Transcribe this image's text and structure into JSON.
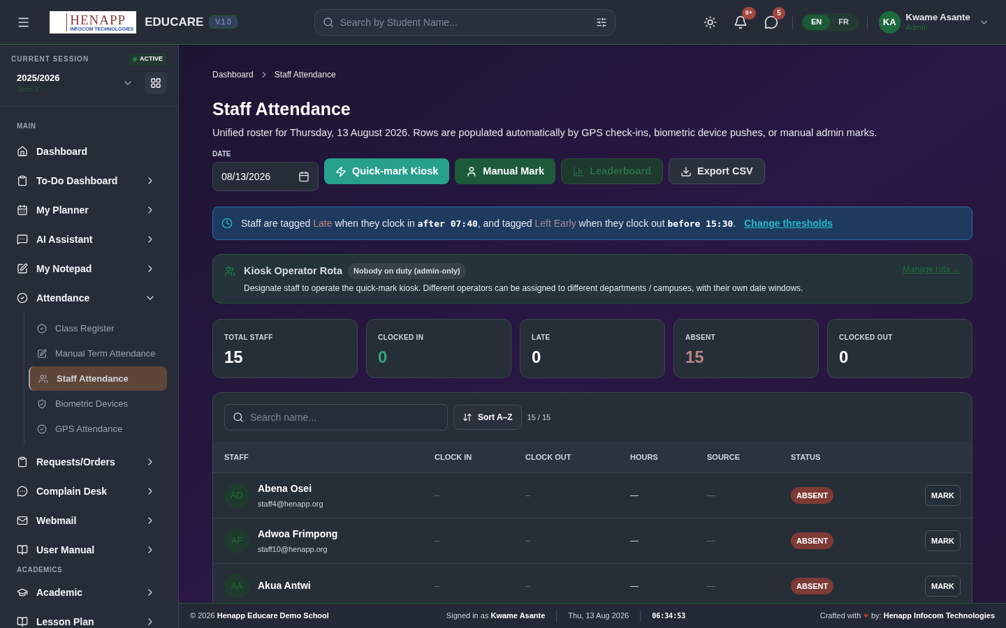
{
  "header": {
    "logo": {
      "name": "HENAPP",
      "tagline": "INFOCOM TECHNOLOGIES"
    },
    "app_name": "EDUCARE",
    "version": "V.1.0",
    "search": {
      "placeholder": "Search by Student Name..."
    },
    "notifications_badge": "9+",
    "messages_badge": "5",
    "languages": [
      {
        "label": "EN",
        "selected": true
      },
      {
        "label": "FR",
        "selected": false
      }
    ],
    "user": {
      "initials": "KA",
      "name": "Kwame Asante",
      "role": "Admin"
    }
  },
  "sidebar": {
    "session_label": "CURRENT SESSION",
    "session_badge": "ACTIVE",
    "session_year": "2025/2026",
    "session_term": "Term 3",
    "sections": [
      {
        "title": "MAIN",
        "items": [
          {
            "label": "Dashboard",
            "expandable": false
          },
          {
            "label": "To-Do Dashboard",
            "expandable": true,
            "expanded": false
          },
          {
            "label": "My Planner",
            "expandable": true,
            "expanded": false
          },
          {
            "label": "AI Assistant",
            "expandable": true,
            "expanded": false
          },
          {
            "label": "My Notepad",
            "expandable": true,
            "expanded": false
          },
          {
            "label": "Attendance",
            "expandable": true,
            "expanded": true,
            "children": [
              {
                "label": "Class Register",
                "selected": false
              },
              {
                "label": "Manual Term Attendance",
                "selected": false
              },
              {
                "label": "Staff Attendance",
                "selected": true
              },
              {
                "label": "Biometric Devices",
                "selected": false
              },
              {
                "label": "GPS Attendance",
                "selected": false
              }
            ]
          },
          {
            "label": "Requests/Orders",
            "expandable": true,
            "expanded": false
          },
          {
            "label": "Complain Desk",
            "expandable": true,
            "expanded": false
          },
          {
            "label": "Webmail",
            "expandable": true,
            "expanded": false
          },
          {
            "label": "User Manual",
            "expandable": true,
            "expanded": false
          }
        ]
      },
      {
        "title": "ACADEMICS",
        "items": [
          {
            "label": "Academic",
            "expandable": true,
            "expanded": false
          },
          {
            "label": "Lesson Plan",
            "expandable": true,
            "expanded": false
          }
        ]
      }
    ]
  },
  "main": {
    "breadcrumb": [
      "Dashboard",
      "Staff Attendance"
    ],
    "title": "Staff Attendance",
    "subtitle": "Unified roster for Thursday, 13 August 2026. Rows are populated automatically by GPS check-ins, biometric device pushes, or manual admin marks.",
    "date": {
      "label": "DATE",
      "value": "08/13/2026"
    },
    "actions": [
      {
        "label": "Quick-mark Kiosk",
        "kind": "primary",
        "disabled": false
      },
      {
        "label": "Manual Mark",
        "kind": "success",
        "disabled": false
      },
      {
        "label": "Leaderboard",
        "kind": "success",
        "disabled": true
      },
      {
        "label": "Export CSV",
        "kind": "outline",
        "disabled": false
      }
    ],
    "notice": {
      "segments": [
        {
          "text": "Staff are tagged ",
          "kind": "plain"
        },
        {
          "text": "Late",
          "kind": "late"
        },
        {
          "text": " when they clock in ",
          "kind": "plain"
        },
        {
          "text": "after 07:40",
          "kind": "code"
        },
        {
          "text": ", and tagged ",
          "kind": "plain"
        },
        {
          "text": "Left Early",
          "kind": "early"
        },
        {
          "text": " when they clock out ",
          "kind": "plain"
        },
        {
          "text": "before 15:30",
          "kind": "code"
        },
        {
          "text": ".",
          "kind": "plain"
        }
      ],
      "link": "Change thresholds"
    },
    "rota": {
      "title": "Kiosk Operator Rota",
      "badge": "Nobody on duty (admin-only)",
      "description": "Designate staff to operate the quick-mark kiosk. Different operators can be assigned to different departments / campuses, with their own date windows.",
      "link": "Manage rota →"
    },
    "stats": [
      {
        "label": "TOTAL STAFF",
        "value": "15",
        "color": "#ffffff"
      },
      {
        "label": "CLOCKED IN",
        "value": "0",
        "color": "#2fa57a"
      },
      {
        "label": "LATE",
        "value": "0",
        "color": "#ffffff"
      },
      {
        "label": "ABSENT",
        "value": "15",
        "color": "#b98585"
      },
      {
        "label": "CLOCKED OUT",
        "value": "0",
        "color": "#ffffff"
      }
    ],
    "table": {
      "search_placeholder": "Search name...",
      "sort_label": "Sort A–Z",
      "count": "15 / 15",
      "columns": [
        "STAFF",
        "CLOCK IN",
        "CLOCK OUT",
        "HOURS",
        "SOURCE",
        "STATUS"
      ],
      "rows": [
        {
          "initials": "AO",
          "name": "Abena Osei",
          "email": "staff4@henapp.org",
          "clock_in": "–",
          "clock_out": "–",
          "hours": "—",
          "source": "—",
          "status": "ABSENT",
          "action": "MARK"
        },
        {
          "initials": "AF",
          "name": "Adwoa Frimpong",
          "email": "staff10@henapp.org",
          "clock_in": "–",
          "clock_out": "–",
          "hours": "—",
          "source": "—",
          "status": "ABSENT",
          "action": "MARK"
        },
        {
          "initials": "AA",
          "name": "Akua Antwi",
          "clock_in": "–",
          "clock_out": "–",
          "hours": "—",
          "source": "—",
          "status": "ABSENT",
          "action": "MARK"
        }
      ]
    }
  },
  "footer": {
    "copyright": "© 2026 **Henapp Educare Demo School**",
    "signed_in": "Signed in as **Kwame Asante**",
    "date": "Thu, 13 Aug 2026",
    "time": "06:34:53",
    "crafted": "Crafted with",
    "heart": "♥",
    "by": "by: **Henapp Infocom Technologies**"
  }
}
